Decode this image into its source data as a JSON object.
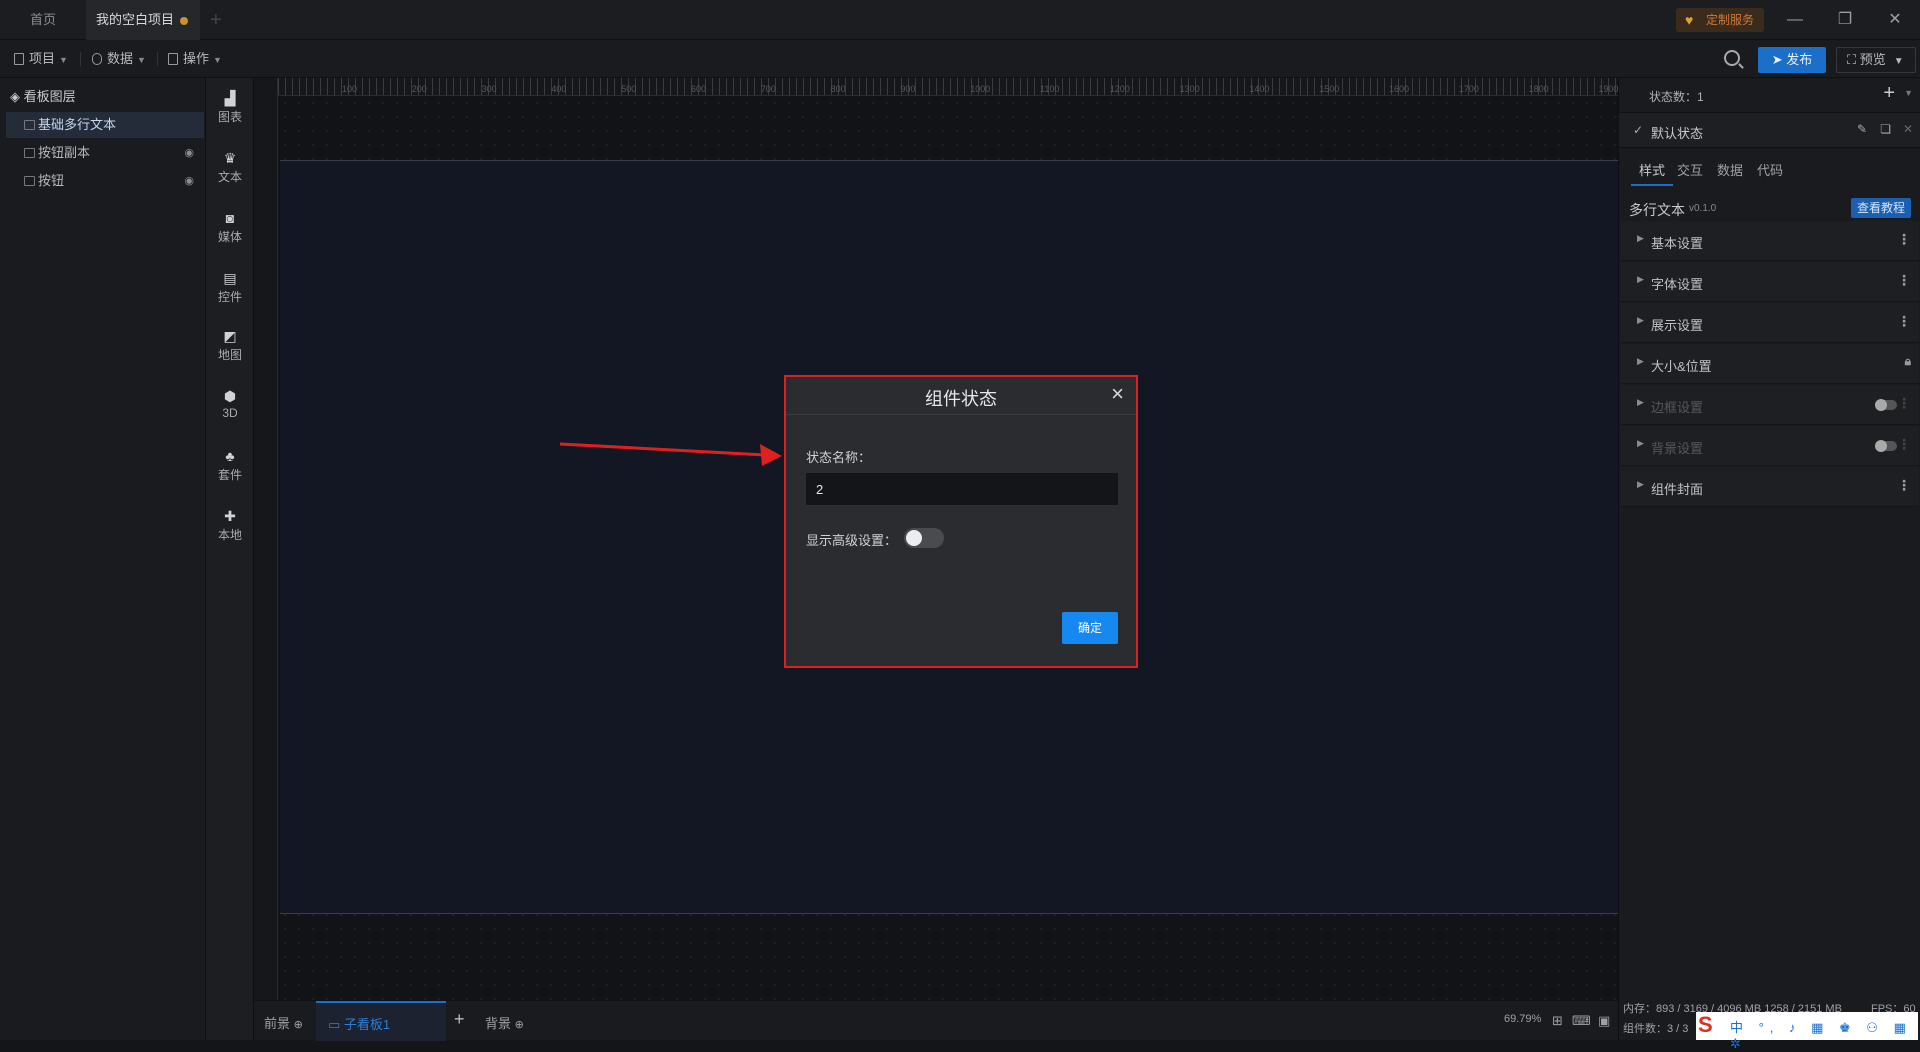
{
  "titlebar": {
    "tabs": [
      {
        "label": "首页"
      },
      {
        "label": "我的空白项目"
      }
    ],
    "custom_service": "定制服务"
  },
  "toolbar": {
    "menus": [
      {
        "label": "项目"
      },
      {
        "label": "数据"
      },
      {
        "label": "操作"
      }
    ],
    "publish": "发布",
    "preview": "预览"
  },
  "layers": {
    "title": "看板图层",
    "items": [
      {
        "label": "基础多行文本",
        "selected": true
      },
      {
        "label": "按钮副本"
      },
      {
        "label": "按钮"
      }
    ]
  },
  "components": [
    {
      "label": "图表",
      "icon": "bar-chart-icon"
    },
    {
      "label": "文本",
      "icon": "crown-icon"
    },
    {
      "label": "媒体",
      "icon": "camera-icon"
    },
    {
      "label": "控件",
      "icon": "widget-icon"
    },
    {
      "label": "地图",
      "icon": "map-icon"
    },
    {
      "label": "3D",
      "icon": "cube-icon"
    },
    {
      "label": "套件",
      "icon": "shirt-icon"
    },
    {
      "label": "本地",
      "icon": "puzzle-icon"
    }
  ],
  "ruler": {
    "h_ticks": [
      "100",
      "200",
      "300",
      "400",
      "500",
      "600",
      "700",
      "800",
      "900",
      "1000",
      "1100",
      "1200",
      "1300",
      "1400",
      "1500",
      "1600",
      "1700",
      "1800",
      "1900"
    ]
  },
  "bottom": {
    "foreground": "前景",
    "subboard": "子看板1",
    "background": "背景",
    "zoom": "69.79%"
  },
  "right_panel": {
    "state_count_label": "状态数：1",
    "default_state": "默认状态",
    "tabs": [
      "样式",
      "交互",
      "数据",
      "代码"
    ],
    "component_name": "多行文本",
    "component_version": "v0.1.0",
    "tutorial": "查看教程",
    "sections": [
      {
        "label": "基本设置",
        "enabled": true
      },
      {
        "label": "字体设置",
        "enabled": true
      },
      {
        "label": "展示设置",
        "enabled": true
      },
      {
        "label": "大小&位置",
        "enabled": true
      },
      {
        "label": "边框设置",
        "enabled": false
      },
      {
        "label": "背景设置",
        "enabled": false
      },
      {
        "label": "组件封面",
        "enabled": true
      }
    ],
    "memory": "内存：893 / 3169 / 4096 MB  1258 / 2151 MB",
    "fps": "FPS：60",
    "component_count": "组件数：3 / 3"
  },
  "modal": {
    "title": "组件状态",
    "state_name_label": "状态名称：",
    "state_name_value": "2",
    "advanced_label": "显示高级设置：",
    "advanced_enabled": false,
    "ok": "确定"
  },
  "colors": {
    "accent": "#1689f0",
    "highlight_border": "#e02020",
    "artboard": "#121723"
  }
}
